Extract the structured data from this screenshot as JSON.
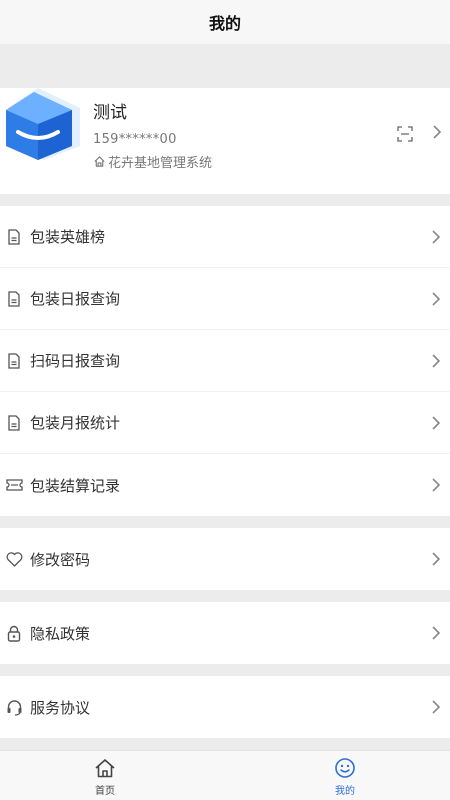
{
  "header": {
    "title": "我的"
  },
  "profile": {
    "name": "测试",
    "phone": "159******00",
    "org": "花卉基地管理系统"
  },
  "menu_groups": [
    {
      "items": [
        {
          "label": "包装英雄榜",
          "icon": "document-icon"
        },
        {
          "label": "包装日报查询",
          "icon": "document-icon"
        },
        {
          "label": "扫码日报查询",
          "icon": "document-icon"
        },
        {
          "label": "包装月报统计",
          "icon": "document-icon"
        },
        {
          "label": "包装结算记录",
          "icon": "ticket-icon"
        }
      ]
    },
    {
      "items": [
        {
          "label": "修改密码",
          "icon": "heart-icon"
        }
      ]
    },
    {
      "items": [
        {
          "label": "隐私政策",
          "icon": "lock-icon"
        }
      ]
    },
    {
      "items": [
        {
          "label": "服务协议",
          "icon": "headset-icon"
        }
      ]
    }
  ],
  "tabbar": [
    {
      "label": "首页",
      "icon": "home-icon",
      "active": false
    },
    {
      "label": "我的",
      "icon": "smile-icon",
      "active": true
    }
  ],
  "colors": {
    "accent": "#2f6fd8",
    "icon_gray": "#555555"
  }
}
